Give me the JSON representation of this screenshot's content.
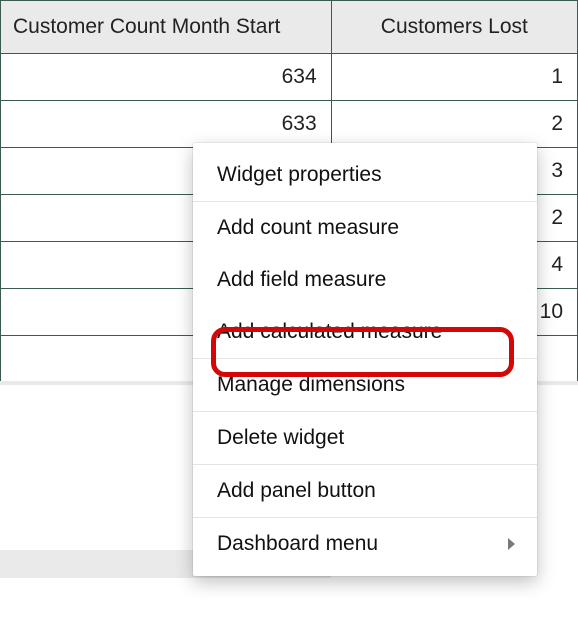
{
  "table": {
    "headers": [
      "Customer Count Month Start",
      "Customers Lost"
    ],
    "rows": [
      {
        "col1": "634",
        "col2": "1"
      },
      {
        "col1": "633",
        "col2": "2"
      },
      {
        "col1": "",
        "col2": "3"
      },
      {
        "col1": "",
        "col2": "2"
      },
      {
        "col1": "",
        "col2": "4"
      },
      {
        "col1": "",
        "col2": "10"
      },
      {
        "col1": "",
        "col2": ""
      }
    ]
  },
  "context_menu": {
    "groups": [
      [
        "Widget properties"
      ],
      [
        "Add count measure",
        "Add field measure",
        "Add calculated measure"
      ],
      [
        "Manage dimensions"
      ],
      [
        "Delete widget"
      ],
      [
        "Add panel button"
      ],
      [
        "Dashboard menu"
      ]
    ],
    "submenu_item": "Dashboard menu",
    "highlighted_item": "Add calculated measure"
  }
}
